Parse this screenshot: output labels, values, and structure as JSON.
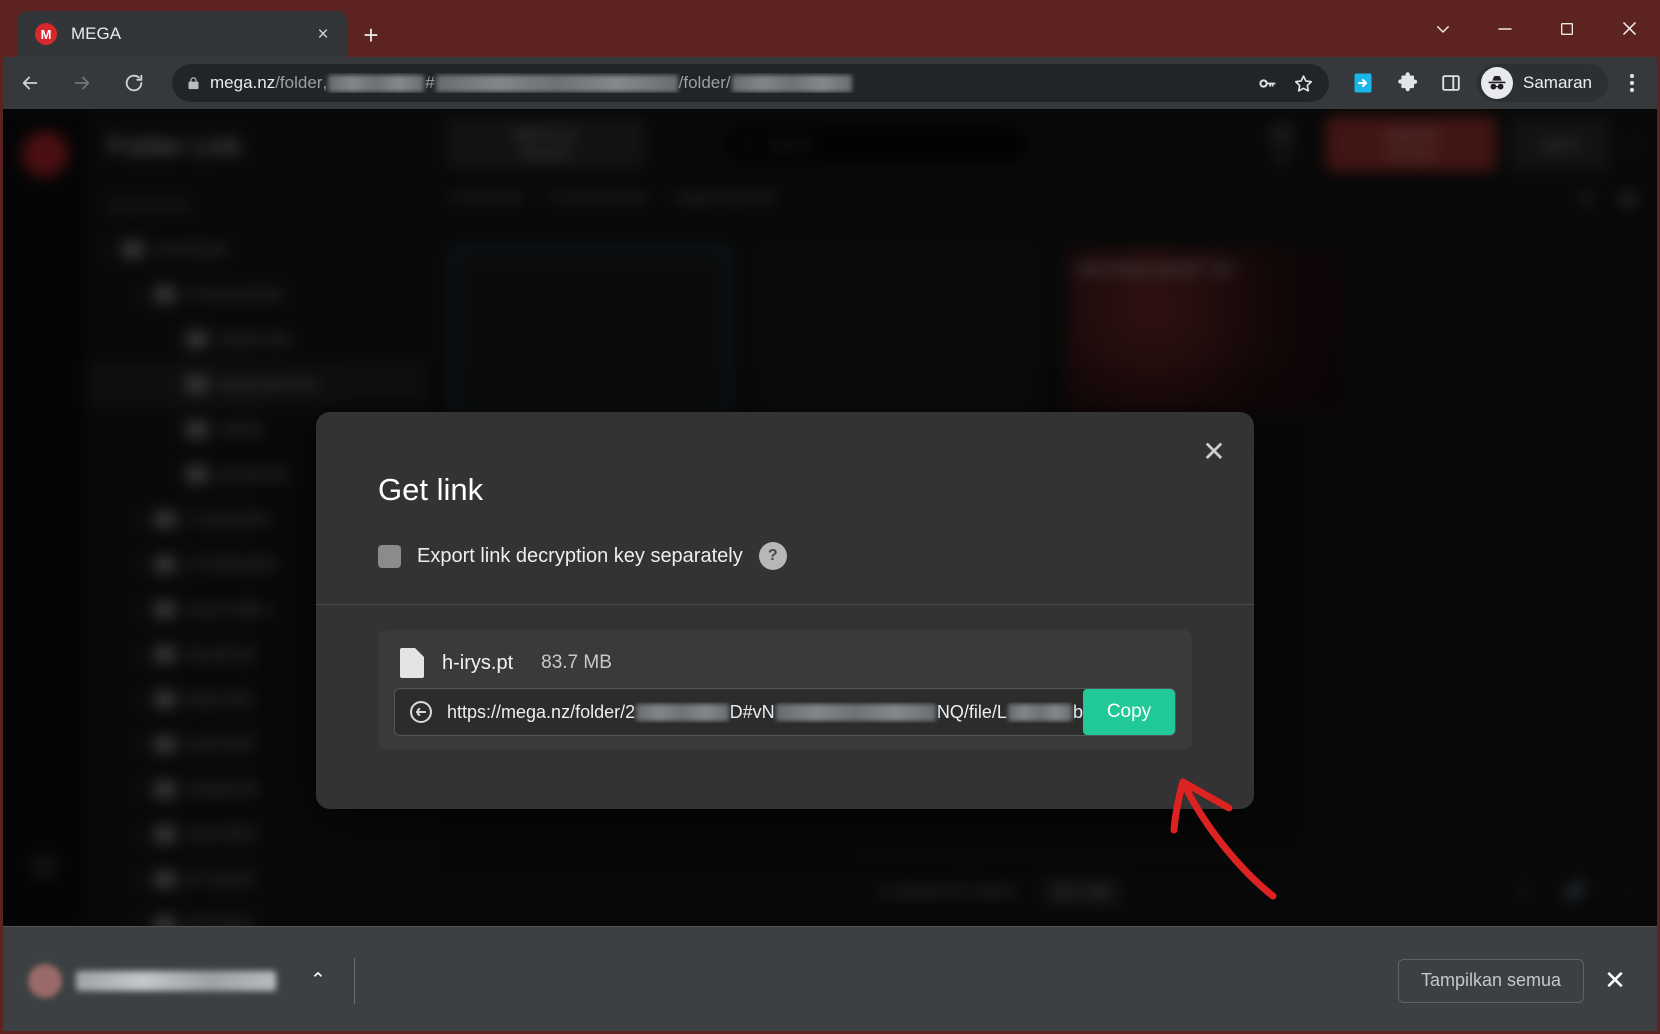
{
  "browser": {
    "tab": {
      "title": "MEGA",
      "favicon_letter": "M",
      "favicon_name": "mega-favicon",
      "close_label": "×"
    },
    "new_tab_label": "+",
    "window_controls": {
      "tab_search": "∨",
      "minimize": "—",
      "maximize": "□",
      "close": "✕"
    },
    "nav": {
      "back": "←",
      "forward": "→",
      "reload": "⟳"
    },
    "omnibox": {
      "url_host": "mega.nz",
      "url_path_1": "/folder",
      "url_sep_1": ",",
      "url_hash": "#",
      "url_path_2": "/folder/",
      "lock_icon": "padlock-icon"
    },
    "toolbar_icons": [
      {
        "name": "password-key-icon",
        "glyph": "⚷"
      },
      {
        "name": "bookmark-star-icon",
        "glyph": "☆"
      },
      {
        "name": "download-extension-icon",
        "glyph": "⬇"
      },
      {
        "name": "extensions-puzzle-icon",
        "glyph": "❖"
      },
      {
        "name": "side-panel-icon",
        "glyph": "▣"
      }
    ],
    "profile": {
      "name": "Samaran",
      "avatar_name": "incognito-avatar"
    },
    "menu_label": "⋮"
  },
  "page_app": {
    "title": "Folder Link",
    "sidebar_caption": "Shared items",
    "tree": [
      {
        "label": "0-Archived",
        "indent": 0,
        "selected": false
      },
      {
        "label": "0-Screenshots",
        "indent": 1,
        "selected": false
      },
      {
        "label": "Starter-kits",
        "indent": 2,
        "selected": false
      },
      {
        "label": "Hypernetworks",
        "indent": 2,
        "selected": true
      },
      {
        "label": "LoRAs",
        "indent": 2,
        "selected": false
      },
      {
        "label": "pt-embeds",
        "indent": 2,
        "selected": false
      },
      {
        "label": "1-Asterix876",
        "indent": 1,
        "selected": false
      },
      {
        "label": "2-TheBook89",
        "indent": 1,
        "selected": false
      },
      {
        "label": "3-per-mello-c",
        "indent": 1,
        "selected": false
      },
      {
        "label": "DeeAE111",
        "indent": 1,
        "selected": false
      },
      {
        "label": "Ditto1248",
        "indent": 1,
        "selected": false
      },
      {
        "label": "newT4p37",
        "indent": 1,
        "selected": false
      },
      {
        "label": "sholkie376",
        "indent": 1,
        "selected": false
      },
      {
        "label": "newY5307",
        "indent": 1,
        "selected": false
      },
      {
        "label": "0771a016",
        "indent": 1,
        "selected": false
      },
      {
        "label": "8227bk05",
        "indent": 1,
        "selected": false
      }
    ],
    "topbar": {
      "restore_btn_line1": "MEGA Up",
      "restore_btn_line2": "Restore",
      "search_placeholder": "Search",
      "storage_label": "0%",
      "upgrade_line1": "Upgrade",
      "upgrade_line2": "account",
      "login_label": "Log in",
      "more_label": "⋮"
    },
    "breadcrumb": [
      "0-Archived",
      "0-Screenshots",
      "Hypernetworks"
    ],
    "breadcrumb_sep": "›",
    "cards": [
      {
        "label": "",
        "selected": true,
        "thumb": false
      },
      {
        "label": "",
        "selected": false,
        "thumb": false
      },
      {
        "label": "one-hub-vect17 )}>",
        "selected": false,
        "thumb": true
      }
    ],
    "status": {
      "selection": "1 selected of 3 items",
      "size_pill": "83.7 MB"
    }
  },
  "modal": {
    "title": "Get link",
    "close_label": "✕",
    "checkbox_label": "Export link decryption key separately",
    "checkbox_checked": false,
    "help_label": "?",
    "file": {
      "name": "h-irys.pt",
      "size": "83.7 MB",
      "icon_name": "file-icon"
    },
    "link": {
      "prefix": "https://mega.nz/folder/2",
      "mid_1": "D#vN",
      "mid_2": "NQ/file/L",
      "suffix": "b",
      "chain_icon": "link-chain-icon"
    },
    "copy_button_label": "Copy",
    "copy_button_color": "#20c997"
  },
  "annotation": {
    "type": "hand-drawn-arrow",
    "color": "#dd2222",
    "points_to": "copy-button"
  },
  "download_bar": {
    "chevron_label": "⌃",
    "show_all_label": "Tampilkan semua",
    "close_label": "✕"
  },
  "colors": {
    "titlebar": "#5c2320",
    "toolbar": "#35393c",
    "modal_bg": "#333333",
    "accent_copy": "#20c997",
    "mega_red": "#c0272d",
    "annotation_red": "#dd2222"
  }
}
